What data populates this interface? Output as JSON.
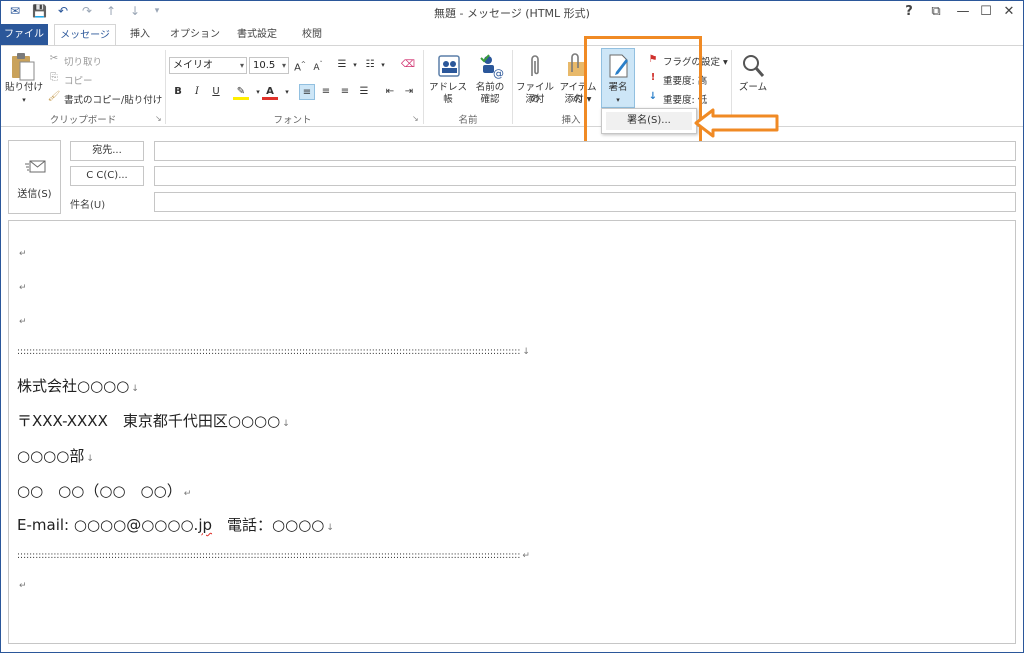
{
  "window": {
    "title": "無題 - メッセージ (HTML 形式)",
    "help": "?",
    "accent": "#2b579a"
  },
  "tabs": [
    {
      "label": "ファイル"
    },
    {
      "label": "メッセージ"
    },
    {
      "label": "挿入"
    },
    {
      "label": "オプション"
    },
    {
      "label": "書式設定"
    },
    {
      "label": "校閲"
    }
  ],
  "ribbon": {
    "clipboard": {
      "paste": "貼り付け",
      "cut": "切り取り",
      "copy": "コピー",
      "format_painter": "書式のコピー/貼り付け",
      "label": "クリップボード"
    },
    "font": {
      "name": "メイリオ",
      "size": "10.5",
      "bold": "B",
      "italic": "I",
      "underline": "U",
      "label": "フォント"
    },
    "names": {
      "address_book": "アドレス帳",
      "check_names_1": "名前の",
      "check_names_2": "確認",
      "label": "名前"
    },
    "insert": {
      "attach_file_1": "ファイルの",
      "attach_file_2": "添付",
      "attach_item_1": "アイテムの",
      "attach_item_2": "添付",
      "signature": "署名",
      "label": "挿入"
    },
    "tags": {
      "flag": "フラグの設定",
      "high": "重要度: 高",
      "low": "重要度: 低"
    },
    "zoom": {
      "zoom": "ズーム"
    }
  },
  "dropdown": {
    "signatures": "署名(S)..."
  },
  "header": {
    "send": "送信(S)",
    "to": "宛先...",
    "cc": "C C(C)...",
    "subject": "件名(U)"
  },
  "body": {
    "dotline": "::::::::::::::::::::::::::::::::::::::::::::::::::::::::::::::::::::::::::::::::::::::::::::::::::::::::::::::::::::::::::::::::::::::::::::::::::::::::::::::::::::::",
    "company": "株式会社○○○○",
    "address": "〒XXX-XXXX　東京都千代田区○○○○",
    "department": "○○○○部",
    "name": "○○　○○（○○　○○）",
    "email_prefix": "E-mail: ○○○○@○○○○.",
    "email_tld": "jp",
    "phone": "　電話：○○○○"
  },
  "colors": {
    "highlight_box": "#f08a24",
    "selected": "#cde6f7"
  }
}
